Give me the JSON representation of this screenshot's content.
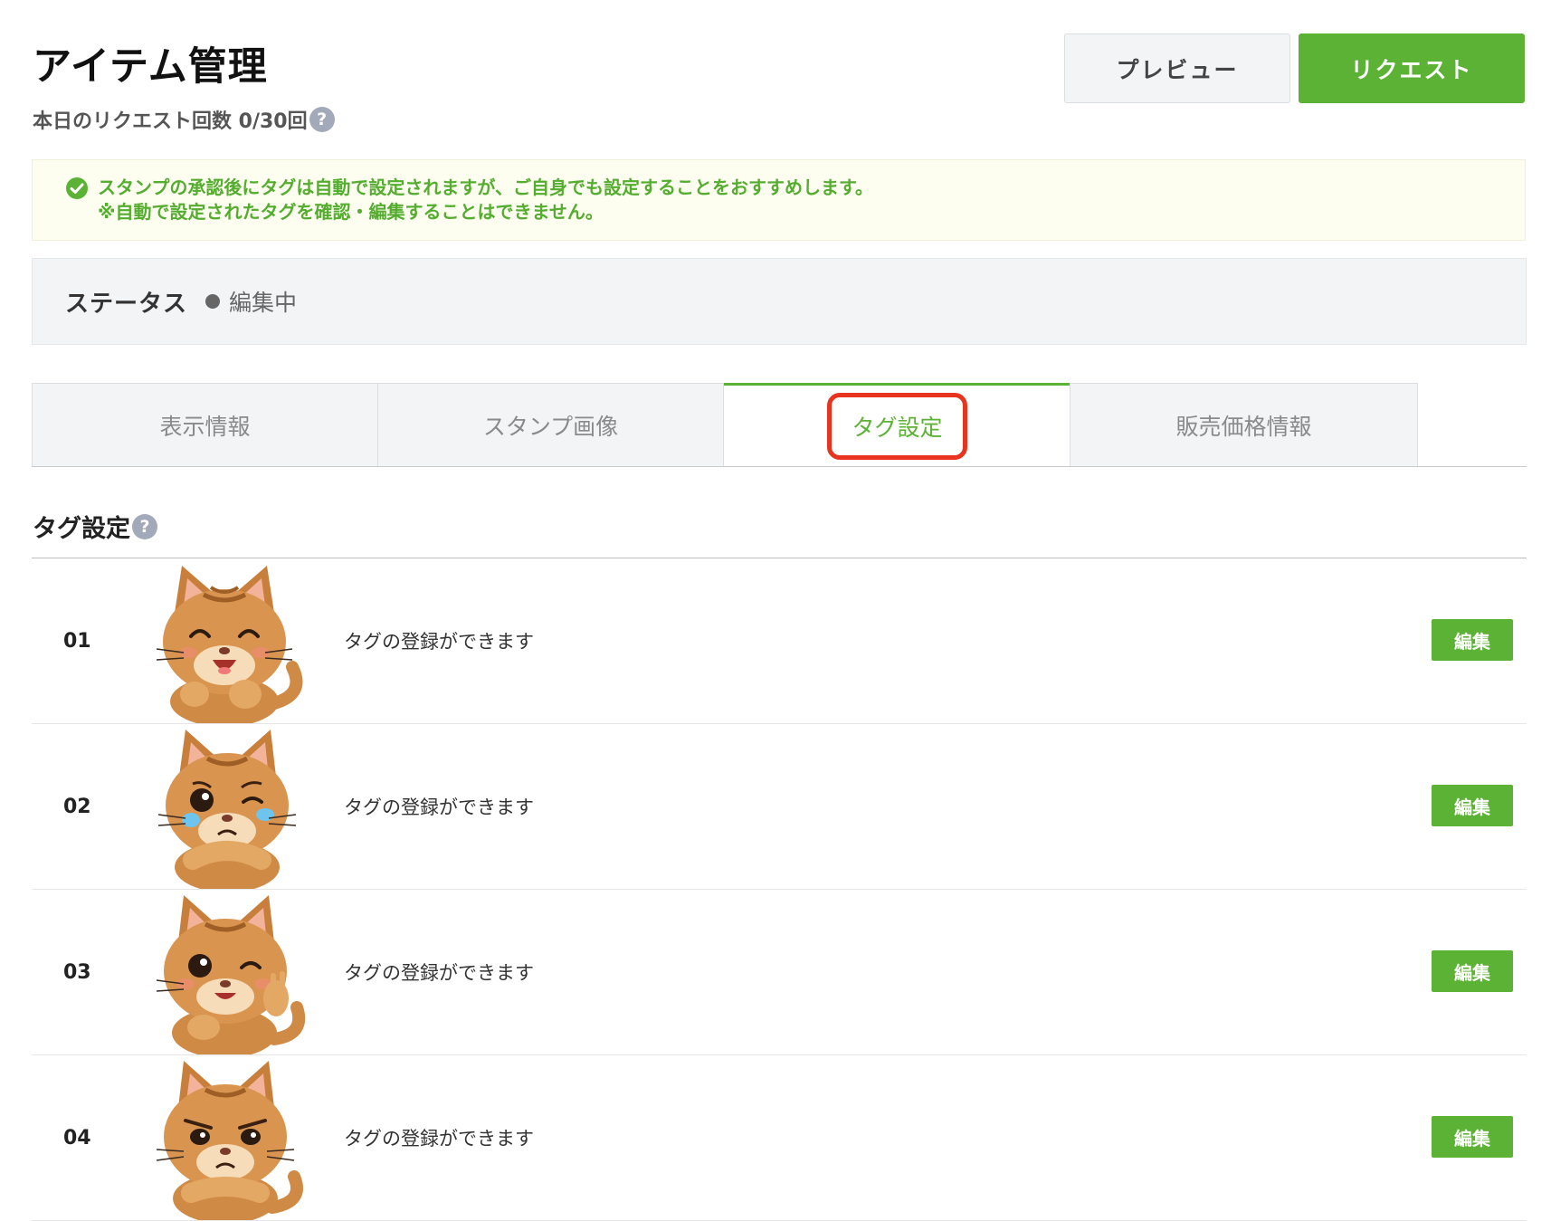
{
  "page": {
    "title": "アイテム管理",
    "request_count": "本日のリクエスト回数 0/30回"
  },
  "buttons": {
    "preview": "プレビュー",
    "request": "リクエスト"
  },
  "notice": {
    "line1": "スタンプの承認後にタグは自動で設定されますが、ご自身でも設定することをおすすめします。",
    "line2": "※自動で設定されたタグを確認・編集することはできません。",
    "icon": "check-circle-icon"
  },
  "status": {
    "label": "ステータス",
    "value": "編集中"
  },
  "tabs": [
    {
      "label": "表示情報",
      "active": false
    },
    {
      "label": "スタンプ画像",
      "active": false
    },
    {
      "label": "タグ設定",
      "active": true
    },
    {
      "label": "販売価格情報",
      "active": false
    }
  ],
  "section": {
    "title": "タグ設定"
  },
  "stickers": [
    {
      "number": "01",
      "text": "タグの登録ができます",
      "edit_label": "編集",
      "image": "laughing-cat-sticker"
    },
    {
      "number": "02",
      "text": "タグの登録ができます",
      "edit_label": "編集",
      "image": "crying-cat-sticker"
    },
    {
      "number": "03",
      "text": "タグの登録ができます",
      "edit_label": "編集",
      "image": "winking-cat-sticker"
    },
    {
      "number": "04",
      "text": "タグの登録ができます",
      "edit_label": "編集",
      "image": "grumpy-cat-sticker"
    }
  ],
  "colors": {
    "accent_green": "#5cb234",
    "highlight_red": "#e8341f",
    "help_icon": "#a2a9b8"
  }
}
